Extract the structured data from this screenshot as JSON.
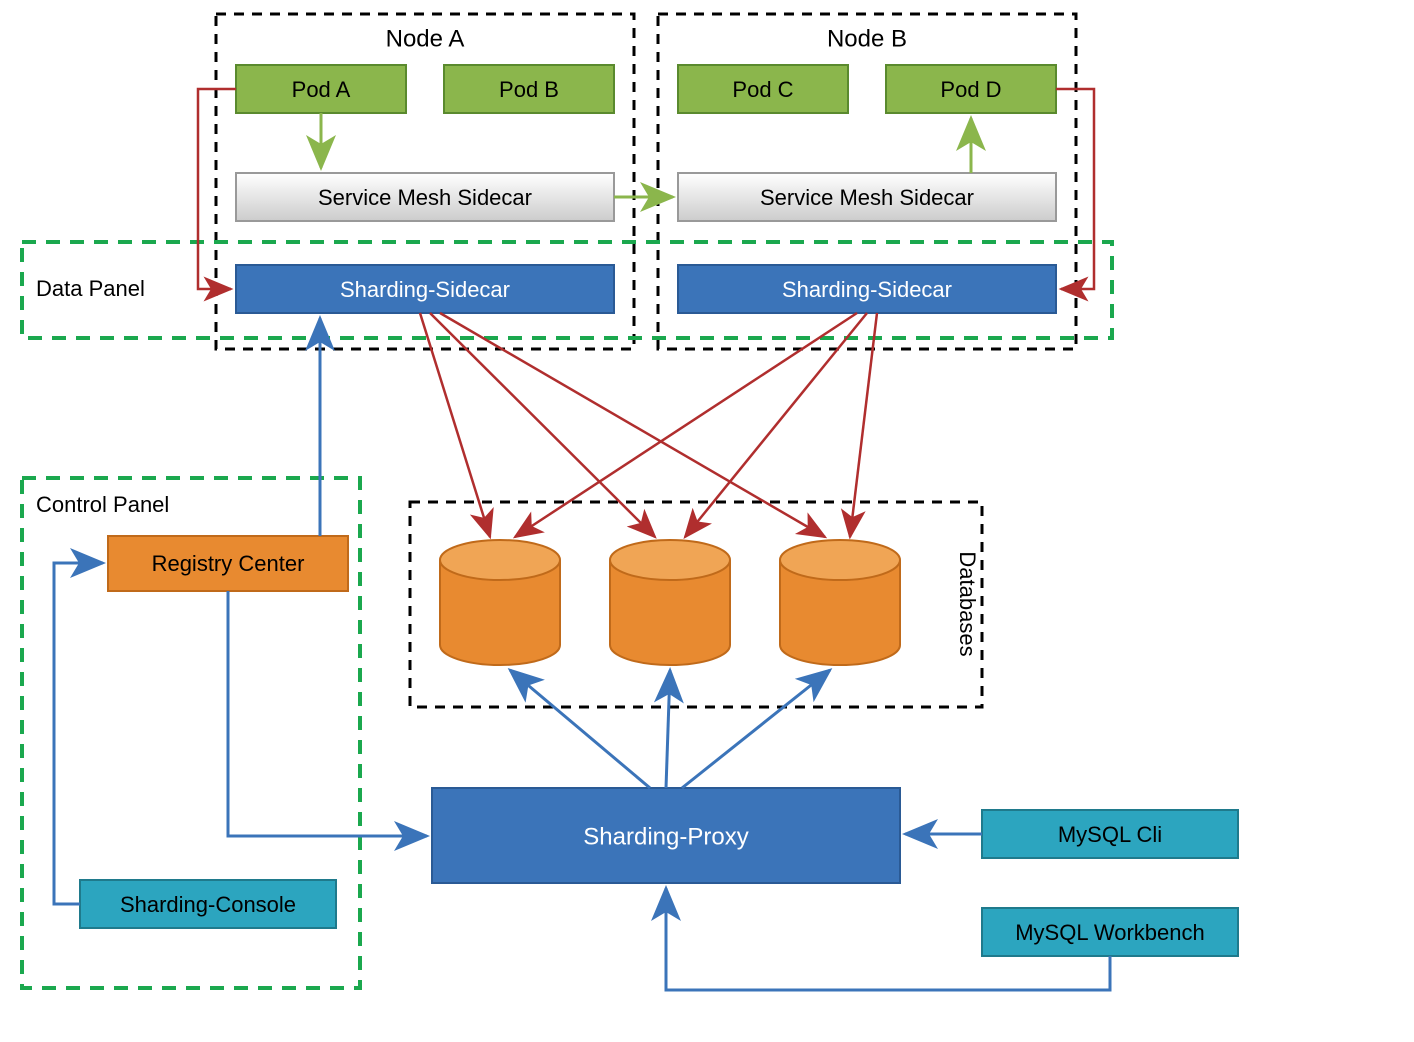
{
  "nodeA": {
    "label": "Node A"
  },
  "nodeB": {
    "label": "Node B"
  },
  "podA": {
    "label": "Pod A"
  },
  "podB": {
    "label": "Pod B"
  },
  "podC": {
    "label": "Pod C"
  },
  "podD": {
    "label": "Pod D"
  },
  "meshA": {
    "label": "Service Mesh Sidecar"
  },
  "meshB": {
    "label": "Service Mesh Sidecar"
  },
  "shardSidecarA": {
    "label": "Sharding-Sidecar"
  },
  "shardSidecarB": {
    "label": "Sharding-Sidecar"
  },
  "dataPanel": {
    "label": "Data Panel"
  },
  "controlPanel": {
    "label": "Control Panel"
  },
  "registryCenter": {
    "label": "Registry Center"
  },
  "shardingConsole": {
    "label": "Sharding-Console"
  },
  "databases": {
    "label": "Databases"
  },
  "shardingProxy": {
    "label": "Sharding-Proxy"
  },
  "mysqlCli": {
    "label": "MySQL Cli"
  },
  "mysqlWorkbench": {
    "label": "MySQL Workbench"
  },
  "colors": {
    "green": "#8BB64C",
    "greenBorder": "#5A8A2E",
    "blue": "#3B74B9",
    "blueBorder": "#2A5A95",
    "teal": "#2CA5BF",
    "tealBorder": "#1F7A8C",
    "orange": "#E88A30",
    "orangeBorder": "#C06A1A",
    "dashGreen": "#1BA84E",
    "redLine": "#B02E2E",
    "blueLine": "#3B74B9",
    "greenLine": "#8BB64C"
  }
}
